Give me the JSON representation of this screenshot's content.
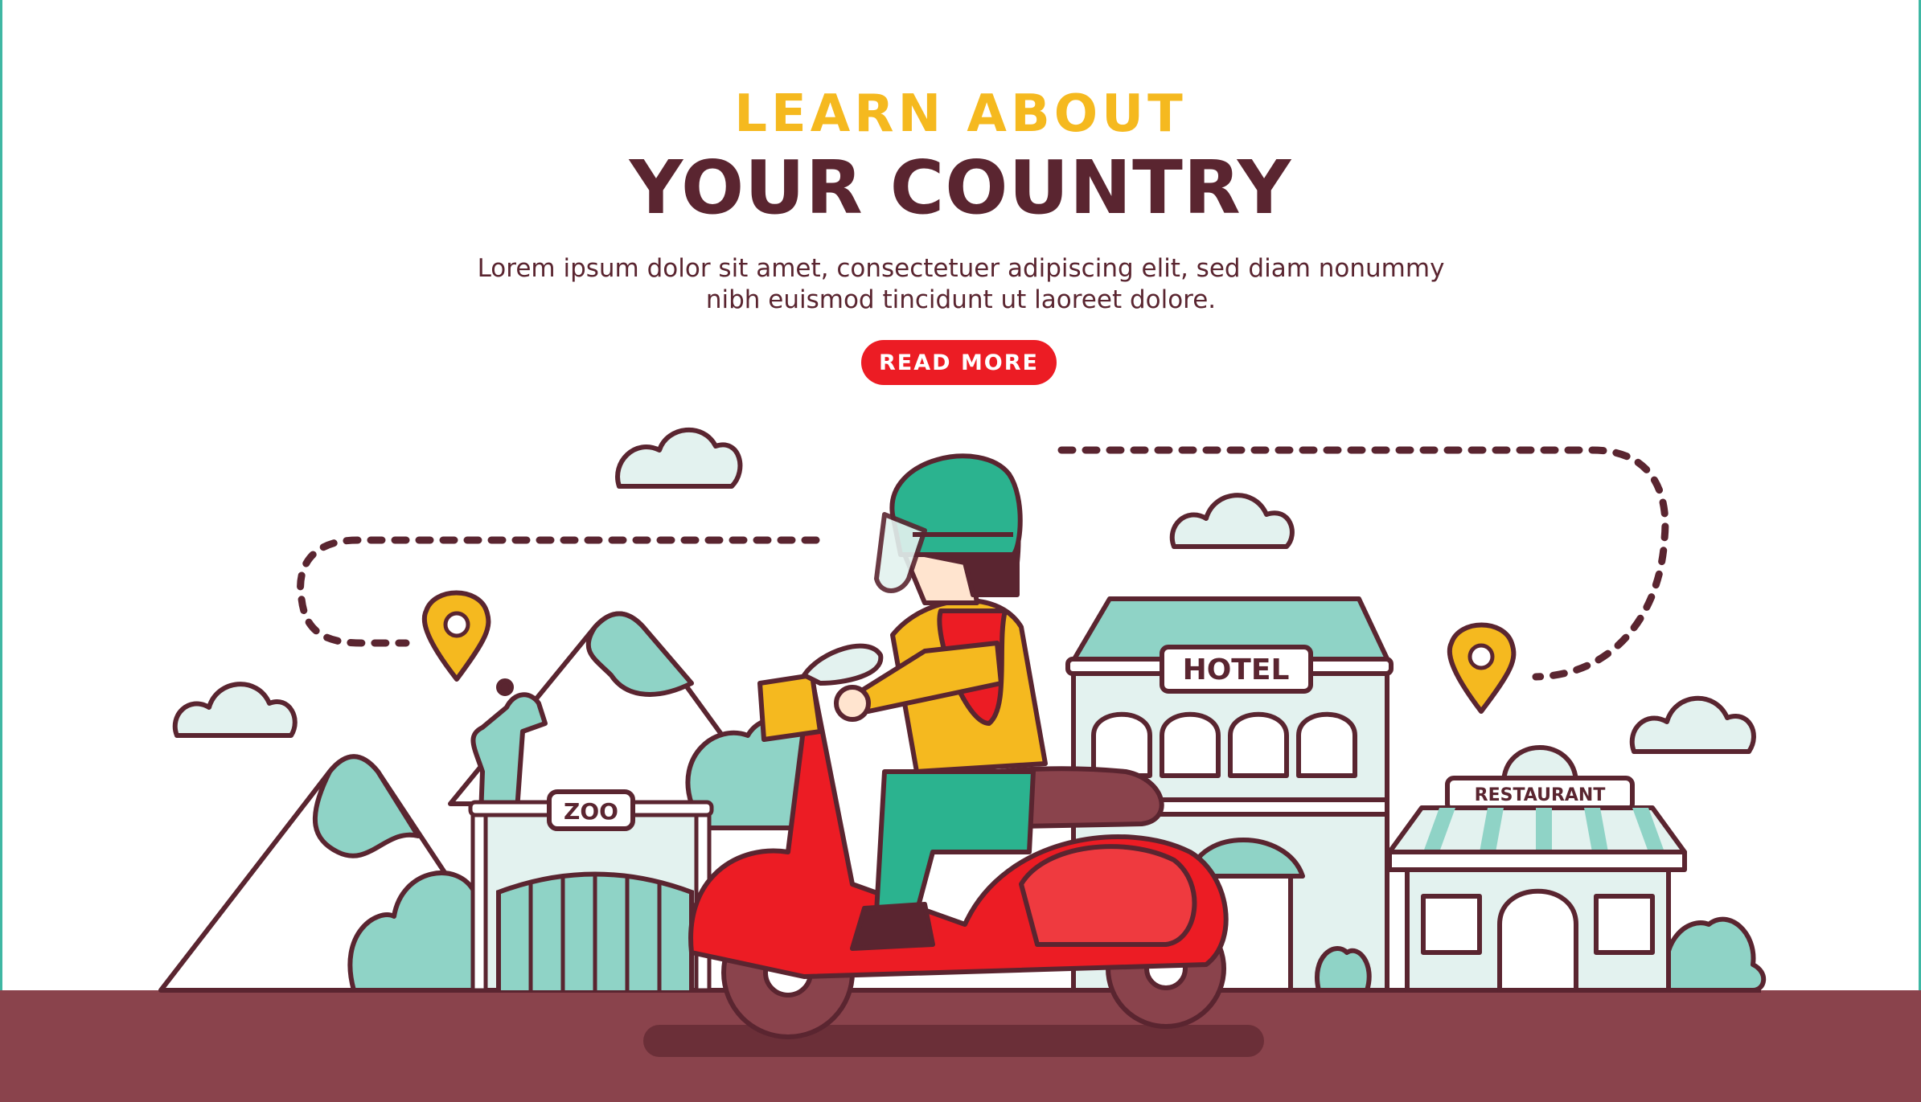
{
  "hero": {
    "kicker": "LEARN ABOUT",
    "title": "YOUR COUNTRY",
    "body_line1": "Lorem ipsum dolor sit amet, consectetuer adipiscing elit, sed diam nonummy",
    "body_line2": "nibh euismod tincidunt ut laoreet dolore.",
    "cta_label": "READ MORE"
  },
  "scene": {
    "signs": {
      "zoo": "ZOO",
      "hotel": "HOTEL",
      "restaurant": "RESTAURANT"
    },
    "icons": [
      "cloud-icon",
      "map-pin-icon",
      "scooter-rider-illustration",
      "mountain-icon",
      "giraffe-icon",
      "tree-icon"
    ]
  },
  "colors": {
    "accent_yellow": "#f5b91f",
    "heading_maroon": "#5a2530",
    "cta_red": "#ec1c24",
    "mint": "#8fd3c6",
    "ground": "#8a434c"
  }
}
